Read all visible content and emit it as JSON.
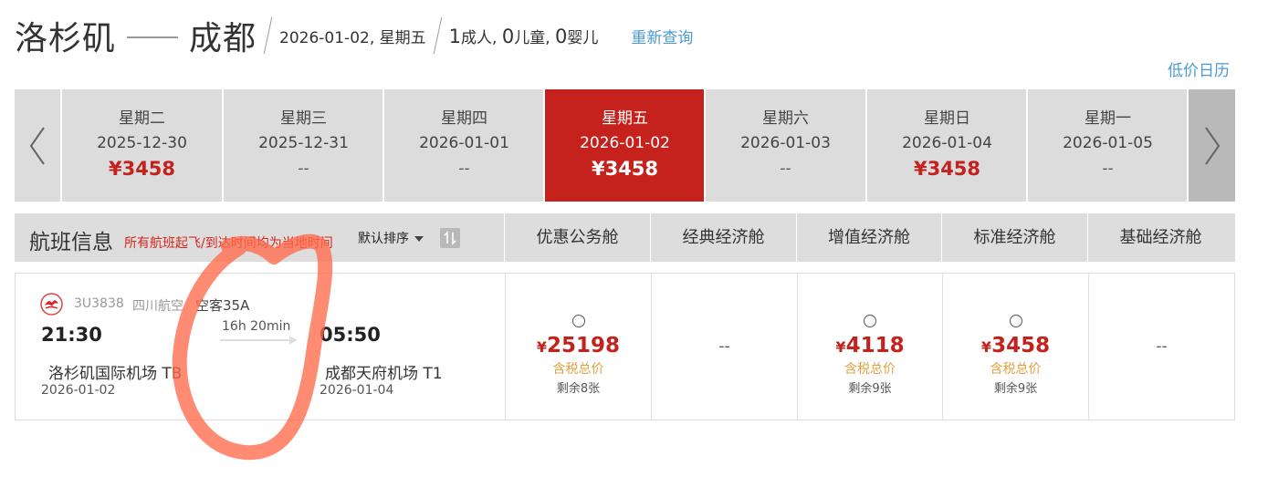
{
  "header": {
    "origin": "洛杉矶",
    "destination": "成都",
    "date": "2026-01-02, 星期五",
    "adults_count": "1",
    "adults_label": "成人,",
    "children_count": "0",
    "children_label": "儿童,",
    "infants_count": "0",
    "infants_label": "婴儿",
    "requery_label": "重新查询",
    "calendar_label": "低价日历"
  },
  "date_strip": {
    "days": [
      {
        "weekday": "星期二",
        "date": "2025-12-30",
        "price": "¥3458",
        "active": false
      },
      {
        "weekday": "星期三",
        "date": "2025-12-31",
        "price": "--",
        "active": false
      },
      {
        "weekday": "星期四",
        "date": "2026-01-01",
        "price": "--",
        "active": false
      },
      {
        "weekday": "星期五",
        "date": "2026-01-02",
        "price": "¥3458",
        "active": true
      },
      {
        "weekday": "星期六",
        "date": "2026-01-03",
        "price": "--",
        "active": false
      },
      {
        "weekday": "星期日",
        "date": "2026-01-04",
        "price": "¥3458",
        "active": false
      },
      {
        "weekday": "星期一",
        "date": "2026-01-05",
        "price": "--",
        "active": false
      }
    ]
  },
  "table_header": {
    "title": "航班信息",
    "note": "所有航班起飞/到达时间均为当地时间",
    "sort_label": "默认排序",
    "cabins": [
      "优惠公务舱",
      "经典经济舱",
      "增值经济舱",
      "标准经济舱",
      "基础经济舱"
    ]
  },
  "flight": {
    "flight_no": "3U3838",
    "airline": "四川航空",
    "aircraft": "空客35A",
    "dep_time": "21:30",
    "arr_time": "05:50",
    "duration": "16h 20min",
    "dep_airport": "洛杉矶国际机场  TB",
    "arr_airport": "成都天府机场  T1",
    "dep_date": "2026-01-02",
    "arr_date": "2026-01-04",
    "cabins": [
      {
        "price": "25198",
        "tax_label": "含税总价",
        "remaining": "剩余8张"
      },
      {
        "price": "--"
      },
      {
        "price": "4118",
        "tax_label": "含税总价",
        "remaining": "剩余9张"
      },
      {
        "price": "3458",
        "tax_label": "含税总价",
        "remaining": "剩余9张"
      },
      {
        "price": "--"
      }
    ],
    "currency": "¥"
  },
  "colors": {
    "accent_red": "#c5211d",
    "link_blue": "#4a9ad4",
    "tax_orange": "#e0a040",
    "annotation": "#ff6a4a"
  }
}
